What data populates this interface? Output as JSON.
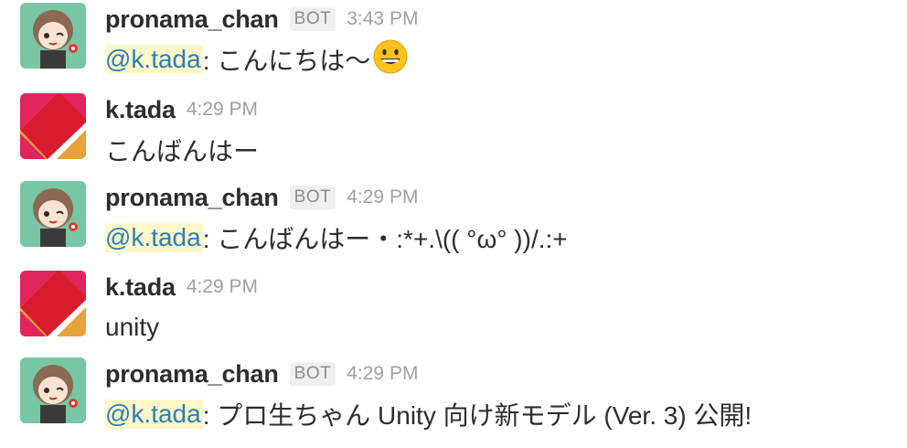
{
  "messages": [
    {
      "user": "pronama_chan",
      "avatar": "pronama-chan-avatar",
      "bot_badge": "BOT",
      "time": "3:43 PM",
      "mention": "@k.tada",
      "text": ": こんにちは〜",
      "emoji": "grinning-face-emoji"
    },
    {
      "user": "k.tada",
      "avatar": "k-tada-avatar",
      "time": "4:29 PM",
      "text": "こんばんはー"
    },
    {
      "user": "pronama_chan",
      "avatar": "pronama-chan-avatar",
      "bot_badge": "BOT",
      "time": "4:29 PM",
      "mention": "@k.tada",
      "text": ": こんばんはー・:*+.\\(( °ω° ))/.:+"
    },
    {
      "user": "k.tada",
      "avatar": "k-tada-avatar",
      "time": "4:29 PM",
      "text": "unity"
    },
    {
      "user": "pronama_chan",
      "avatar": "pronama-chan-avatar",
      "bot_badge": "BOT",
      "time": "4:29 PM",
      "mention": "@k.tada",
      "text": ": プロ生ちゃん Unity 向け新モデル (Ver. 3) 公開!"
    }
  ],
  "colors": {
    "mention_bg": "#fff6c9",
    "mention_text": "#2a80b9",
    "name_text": "#2c2d30",
    "time_text": "#a0a0a2",
    "badge_bg": "#efefef"
  }
}
